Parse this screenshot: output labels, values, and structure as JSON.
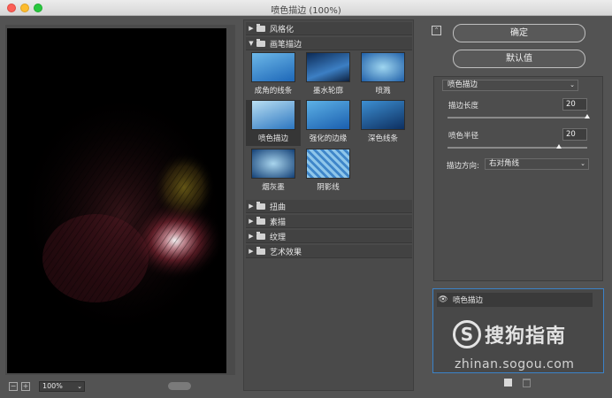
{
  "window": {
    "title": "喷色描边 (100%)"
  },
  "preview": {
    "zoom": "100%"
  },
  "gallery": {
    "categories_top": [
      {
        "label": "风格化",
        "expanded": false
      },
      {
        "label": "画笔描边",
        "expanded": true
      }
    ],
    "filters": [
      {
        "label": "成角的线条"
      },
      {
        "label": "墨水轮廓"
      },
      {
        "label": "喷溅"
      },
      {
        "label": "喷色描边",
        "selected": true
      },
      {
        "label": "强化的边缘"
      },
      {
        "label": "深色线条"
      },
      {
        "label": "烟灰墨"
      },
      {
        "label": "阴影线"
      }
    ],
    "categories_bottom": [
      {
        "label": "扭曲"
      },
      {
        "label": "素描"
      },
      {
        "label": "纹理"
      },
      {
        "label": "艺术效果"
      }
    ]
  },
  "buttons": {
    "ok": "确定",
    "default": "默认值"
  },
  "settings": {
    "filter_name": "喷色描边",
    "stroke_length": {
      "label": "描边长度",
      "value": "20",
      "fraction": 1.0
    },
    "spray_radius": {
      "label": "喷色半径",
      "value": "20",
      "fraction": 0.8
    },
    "direction": {
      "label": "描边方向:",
      "value": "右对角线"
    }
  },
  "layers": [
    {
      "name": "喷色描边",
      "visible": true
    }
  ],
  "watermark": {
    "brand": "搜狗指南",
    "url": "zhinan.sogou.com",
    "logo_letter": "S"
  },
  "colors": {
    "selection_border": "#3b82c8",
    "panel_bg": "#535353"
  }
}
